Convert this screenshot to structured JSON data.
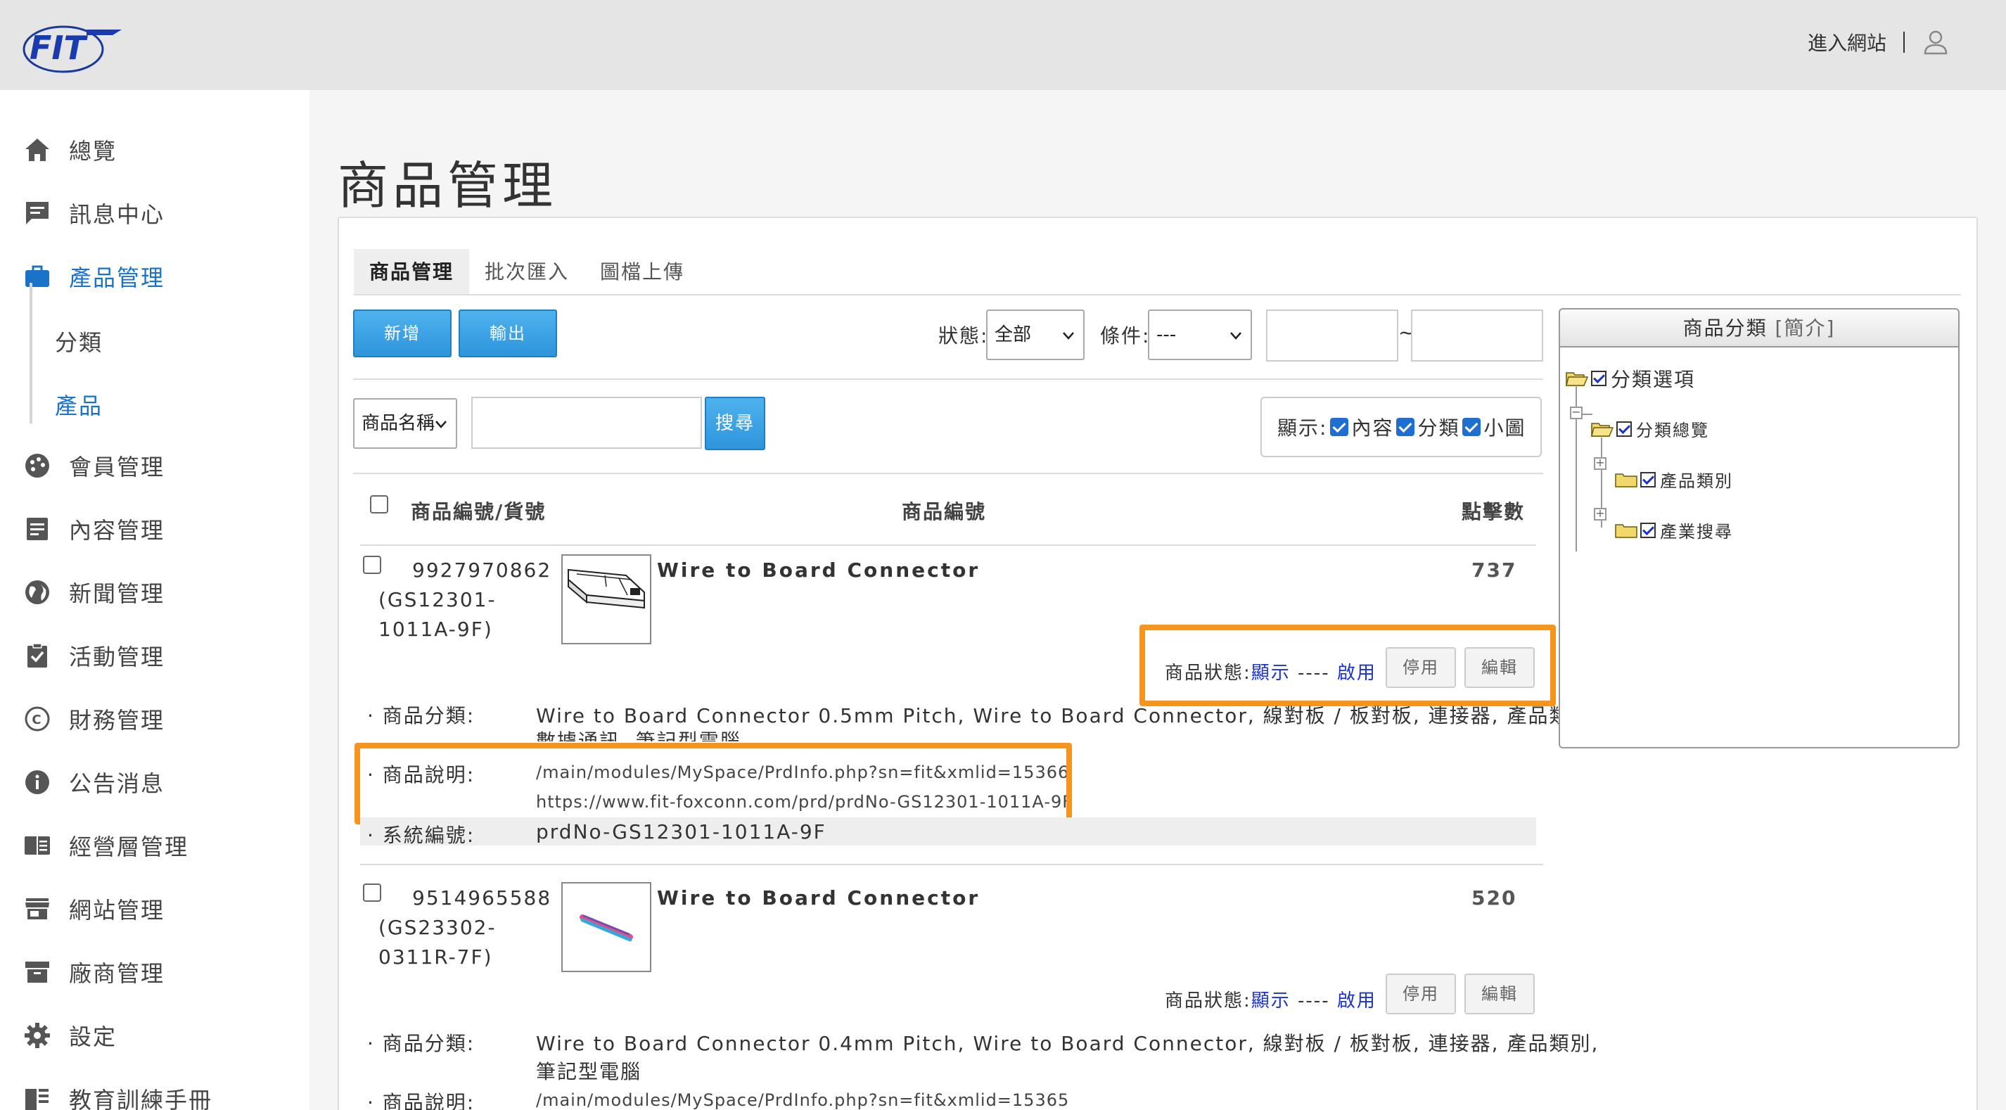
{
  "header": {
    "enter_site": "進入網站"
  },
  "sidebar": {
    "items": [
      {
        "label": "總覽"
      },
      {
        "label": "訊息中心"
      },
      {
        "label": "產品管理"
      },
      {
        "label": "會員管理"
      },
      {
        "label": "內容管理"
      },
      {
        "label": "新聞管理"
      },
      {
        "label": "活動管理"
      },
      {
        "label": "財務管理"
      },
      {
        "label": "公告消息"
      },
      {
        "label": "經營層管理"
      },
      {
        "label": "網站管理"
      },
      {
        "label": "廠商管理"
      },
      {
        "label": "設定"
      },
      {
        "label": "教育訓練手冊"
      }
    ],
    "sub_items": [
      {
        "label": "分類"
      },
      {
        "label": "產品"
      }
    ]
  },
  "page": {
    "title": "商品管理"
  },
  "tabs": [
    {
      "label": "商品管理"
    },
    {
      "label": "批次匯入"
    },
    {
      "label": "圖檔上傳"
    }
  ],
  "toolbar": {
    "add_label": "新增",
    "export_label": "輸出",
    "status_label": "狀態:",
    "status_value": "全部",
    "condition_label": "條件:",
    "condition_value": "---",
    "range_sep": "~",
    "search_field": "商品名稱",
    "search_label": "搜尋",
    "display_label": "顯示:",
    "display_options": [
      "內容",
      "分類",
      "小圖"
    ]
  },
  "table": {
    "headers": {
      "id": "商品編號/貨號",
      "name": "商品編號",
      "clicks": "點擊數"
    },
    "rows": [
      {
        "id_line1": "9927970862",
        "id_line2": "(GS12301-",
        "id_line3": "1011A-9F)",
        "name": "Wire to Board Connector",
        "clicks": "737",
        "status_label": "商品狀態:",
        "status_show": "顯示",
        "status_sep": "----",
        "status_enable": "啟用",
        "disable_label": "停用",
        "edit_label": "編輯",
        "category_label": "· 商品分類:",
        "category_line1": "Wire to Board Connector 0.5mm Pitch, Wire to Board Connector, 線對板 / 板對板, 連接器, 產品類別,",
        "category_line2": "數據通訊, 筆記型電腦",
        "desc_label": "· 商品說明:",
        "desc_line1": "/main/modules/MySpace/PrdInfo.php?sn=fit&xmlid=15366",
        "desc_line2": "https://www.fit-foxconn.com/prd/prdNo-GS12301-1011A-9F",
        "sys_label": "· 系統編號:",
        "sys_value": "prdNo-GS12301-1011A-9F"
      },
      {
        "id_line1": "9514965588",
        "id_line2": "(GS23302-",
        "id_line3": "0311R-7F)",
        "name": "Wire to Board Connector",
        "clicks": "520",
        "status_label": "商品狀態:",
        "status_show": "顯示",
        "status_sep": "----",
        "status_enable": "啟用",
        "disable_label": "停用",
        "edit_label": "編輯",
        "category_label": "· 商品分類:",
        "category_line1": "Wire to Board Connector 0.4mm Pitch, Wire to Board Connector, 線對板 / 板對板, 連接器, 產品類別,",
        "category_line2": "筆記型電腦",
        "desc_label": "· 商品說明:",
        "desc_line1": "/main/modules/MySpace/PrdInfo.php?sn=fit&xmlid=15365"
      }
    ]
  },
  "category_panel": {
    "title": "商品分類",
    "intro": "[簡介]",
    "root": "分類選項",
    "overview": "分類總覽",
    "children": [
      "產品類別",
      "產業搜尋"
    ]
  },
  "colors": {
    "accent": "#1a73c9",
    "highlight": "#f7941d",
    "button_blue": "#2e95db"
  }
}
